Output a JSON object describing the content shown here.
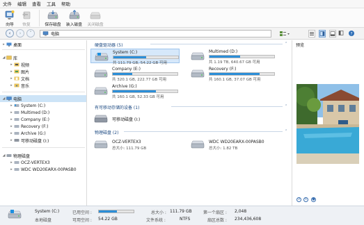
{
  "menu": [
    "文件",
    "编辑",
    "查看",
    "工具",
    "帮助"
  ],
  "ribbon": {
    "wizard": "向导",
    "recover": "恢复",
    "save_disk": "保存磁盘",
    "load_disk": "装入磁盘",
    "close_disk": "关闭磁盘"
  },
  "address": {
    "path": "电脑"
  },
  "tree": {
    "desktop": "桌面",
    "library": "库",
    "library_items": [
      "视频",
      "图片",
      "文档",
      "音乐"
    ],
    "computer": "电脑",
    "computer_items": [
      "System (C:)",
      "Multimed (D:)",
      "Company (E:)",
      "Recovery (F:)",
      "Archive (G:)",
      "可移动磁盘 (I:)"
    ],
    "physical": "物理磁盘",
    "physical_items": [
      "OCZ-VERTEX3",
      "WDC WD20EARX-00PASB0"
    ]
  },
  "sections": {
    "hard_drives": "硬盘驱动器 (5)",
    "removable": "有可移动存储的设备 (1)",
    "physical": "物理磁盘 (2)"
  },
  "drives": [
    {
      "name": "System (C:)",
      "info": "共 111.79 GB, 54.22 GB 可用",
      "used_pct": 51
    },
    {
      "name": "Multimed (D:)",
      "info": "共 1.19 TB, 640.67 GB 可用",
      "used_pct": 47
    },
    {
      "name": "Company (E:)",
      "info": "共 320.1 GB, 222.77 GB 可用",
      "used_pct": 30
    },
    {
      "name": "Recovery (F:)",
      "info": "共 160.1 GB, 37.07 GB 可用",
      "used_pct": 77
    },
    {
      "name": "Archive (G:)",
      "info": "共 160.1 GB, 52.33 GB 可用",
      "used_pct": 67
    }
  ],
  "removable": [
    {
      "name": "可移动磁盘 (I:)"
    }
  ],
  "physical": [
    {
      "name": "OCZ-VERTEX3",
      "info": "总大小: 111.79 GB"
    },
    {
      "name": "WDC WD20EARX-00PASB0",
      "info": "总大小: 1.82 TB"
    }
  ],
  "preview": {
    "title": "预览"
  },
  "status": {
    "drive": "System (C:)",
    "type": "本地磁盘",
    "used_label": "已用空间 :",
    "free_label": "可用空间 :",
    "free_value": "54.22 GB",
    "used_pct": 51,
    "total_label": "总大小 :",
    "total_value": "111.79 GB",
    "fs_label": "文件系统 :",
    "fs_value": "NTFS",
    "first_sector_label": "第一个扇区 :",
    "first_sector_value": "2,048",
    "sector_count_label": "扇区总数 :",
    "sector_count_value": "234,436,608"
  }
}
